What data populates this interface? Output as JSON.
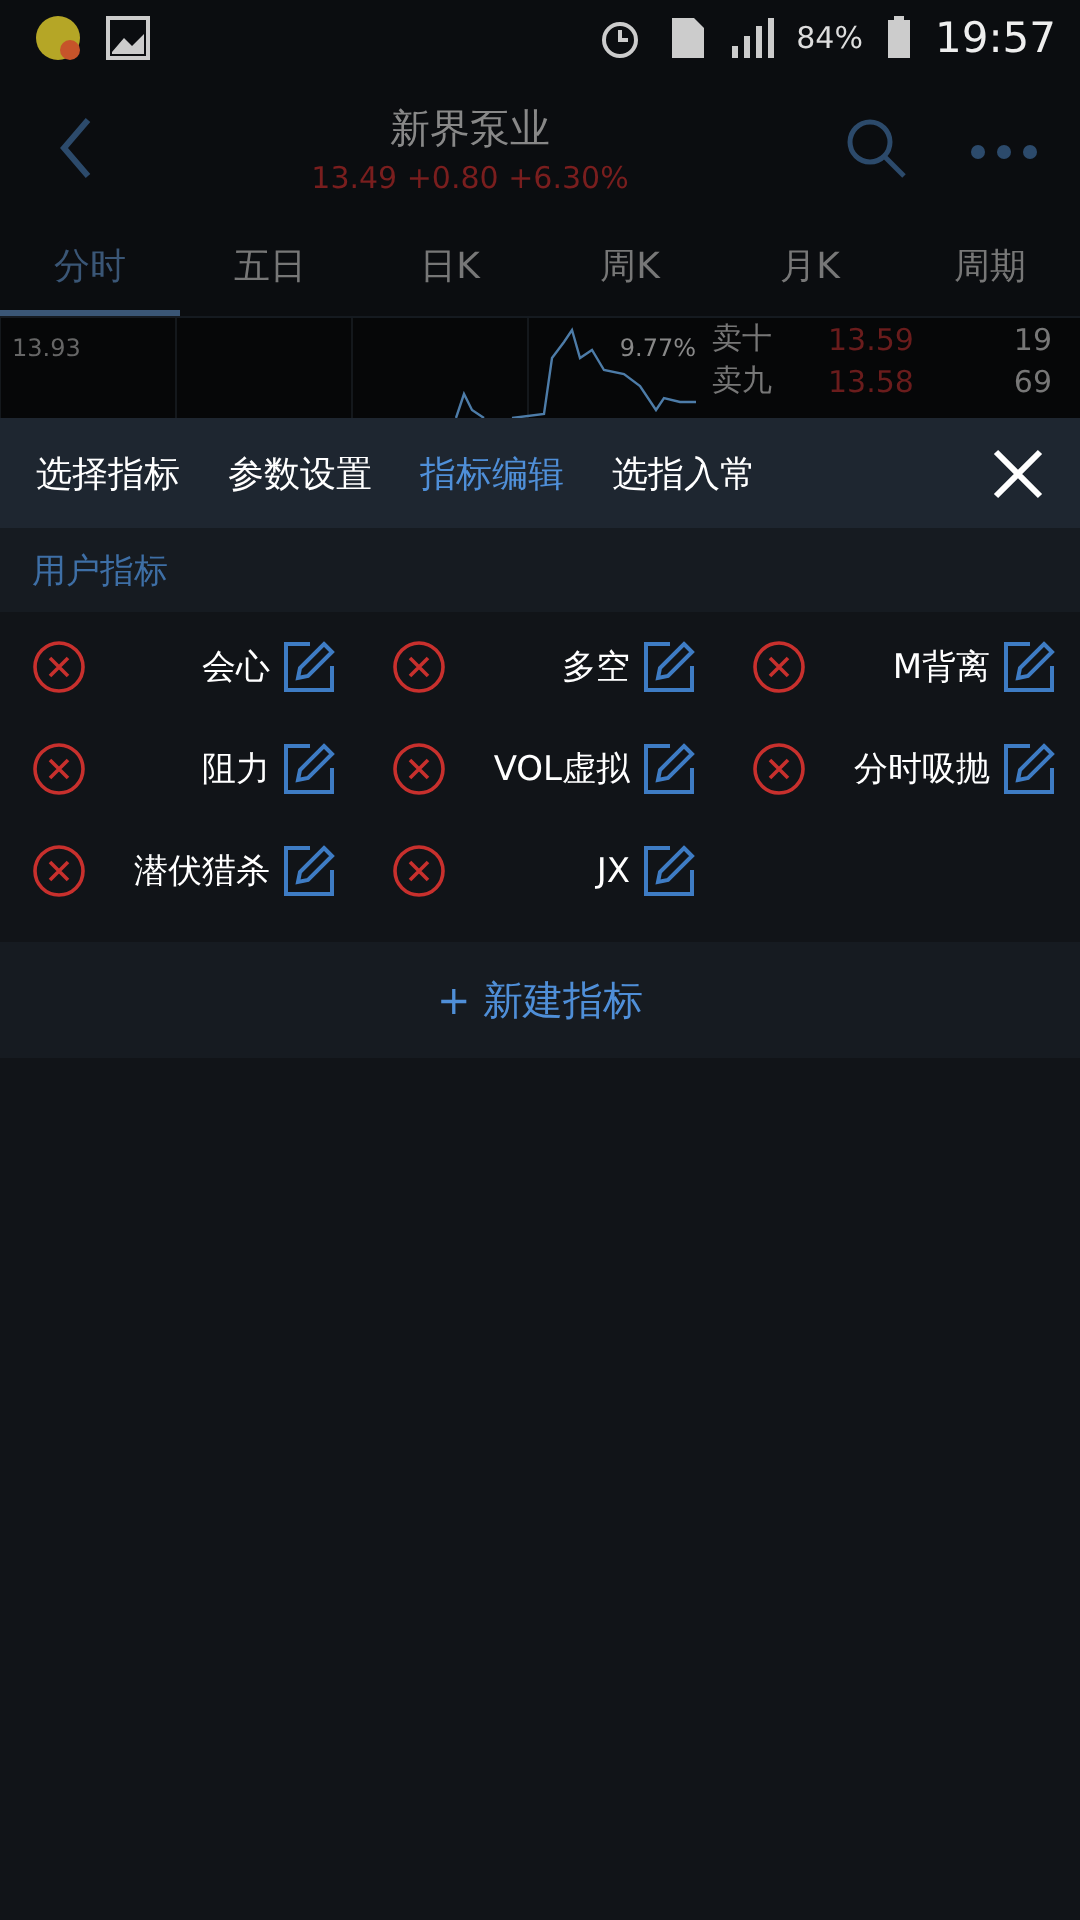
{
  "status_bar": {
    "battery": "84%",
    "time": "19:57"
  },
  "header": {
    "title": "新界泵业",
    "quote": "13.49 +0.80 +6.30%"
  },
  "tabs": [
    {
      "label": "分时",
      "selected": true
    },
    {
      "label": "五日",
      "selected": false
    },
    {
      "label": "日K",
      "selected": false
    },
    {
      "label": "周K",
      "selected": false
    },
    {
      "label": "月K",
      "selected": false
    },
    {
      "label": "周期",
      "selected": false
    }
  ],
  "chart": {
    "high": "13.93",
    "change": "9.77%"
  },
  "order_book": [
    {
      "label": "卖十",
      "price": "13.59",
      "volume": "19"
    },
    {
      "label": "卖九",
      "price": "13.58",
      "volume": "69"
    }
  ],
  "panel_tabs": [
    {
      "label": "选择指标",
      "selected": false
    },
    {
      "label": "参数设置",
      "selected": false
    },
    {
      "label": "指标编辑",
      "selected": true
    },
    {
      "label": "选指入常",
      "selected": false
    }
  ],
  "section": {
    "title": "用户指标"
  },
  "indicators": [
    {
      "name": "会心"
    },
    {
      "name": "多空"
    },
    {
      "name": "M背离"
    },
    {
      "name": "阻力"
    },
    {
      "name": "VOL虚拟"
    },
    {
      "name": "分时吸抛"
    },
    {
      "name": "潜伏猎杀"
    },
    {
      "name": "JX"
    }
  ],
  "add_button": {
    "label": "+ 新建指标"
  }
}
